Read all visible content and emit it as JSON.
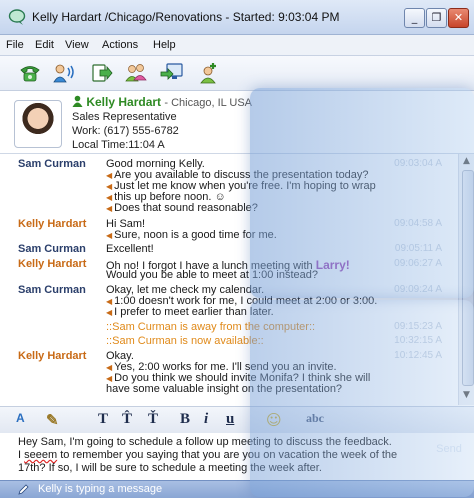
{
  "window": {
    "title": "Kelly Hardart /Chicago/Renovations - Started: 9:03:04 PM",
    "minimize": "_",
    "restore": "❐",
    "close": "✕"
  },
  "menu": [
    "File",
    "Edit",
    "View",
    "Actions",
    "Help"
  ],
  "toolbar": {
    "icons": [
      "phone-icon",
      "audio-contact-icon",
      "transfer-icon",
      "invite-people-icon",
      "screen-share-icon",
      "add-contact-icon"
    ]
  },
  "contact": {
    "name": "Kelly Hardart",
    "location": "- Chicago, IL USA",
    "title": "Sales Representative",
    "work": "Work: (617) 555-6782",
    "local_time": "Local Time:11:04 A"
  },
  "conversation": [
    {
      "sender": "Sam Curman",
      "who": "sam",
      "time": "09:03:04 A",
      "lines": [
        "Good morning Kelly.",
        "Are you available to discuss the presentation today?",
        "Just let me know when you're free. I'm hoping to wrap",
        "this up before noon. ☺",
        "Does that sound reasonable?"
      ]
    },
    {
      "sender": "Kelly Hardart",
      "who": "kelly",
      "time": "09:04:58 A",
      "lines": [
        "Hi Sam!",
        "Sure, noon is a good time for me."
      ]
    },
    {
      "sender": "Sam Curman",
      "who": "sam",
      "time": "09:05:11 A",
      "lines": [
        "Excellent!"
      ]
    },
    {
      "sender": "Kelly Hardart",
      "who": "kelly",
      "time": "09:06:27 A",
      "lines": [
        "Oh no! I forgot I have a lunch meeting with Larry!",
        "Would you be able to meet at 1:00 instead?"
      ]
    },
    {
      "sender": "Sam Curman",
      "who": "sam",
      "time": "09:09:24 A",
      "lines": [
        "Okay, let me check my calendar.",
        "1:00 doesn't work for me, I could meet at 2:00 or 3:00.",
        "I prefer to meet earlier than later."
      ]
    },
    {
      "status": "::Sam Curman is away from the computer::",
      "time": "09:15:23 A"
    },
    {
      "status": "::Sam Curman is now available::",
      "time": "10:32:15 A"
    },
    {
      "sender": "Kelly Hardart",
      "who": "kelly",
      "time": "10:12:45 A",
      "lines": [
        "Okay.",
        "Yes, 2:00 works for me. I'll send you an invite.",
        "Do you think we should invite Monifa? I think she will",
        "have some valuable insight on the presentation?"
      ]
    }
  ],
  "format_buttons": [
    "A",
    "✎",
    "T",
    "T̂",
    "Ť",
    "B",
    "i",
    "u",
    "☺",
    "abc"
  ],
  "compose": {
    "line1": "Hey Sam, I'm going to schedule a follow up meeting to discuss the feedback.",
    "line2_pre": "I ",
    "misspelled": "seeem",
    "line2_post": " to remember you saying that you are you on vacation the week of the",
    "line3": "17th? If so, I will be sure to schedule a meeting the week after.",
    "send_label": "Send"
  },
  "status_bar": {
    "text": "Kelly is typing a message"
  },
  "colors": {
    "sam_name": "#2b3f6b",
    "kelly_name": "#c86a16",
    "status": "#e08a1a",
    "mention": "#9a3fb0",
    "contact_green": "#2e8a23",
    "statusbar": "#8aa6d4"
  }
}
